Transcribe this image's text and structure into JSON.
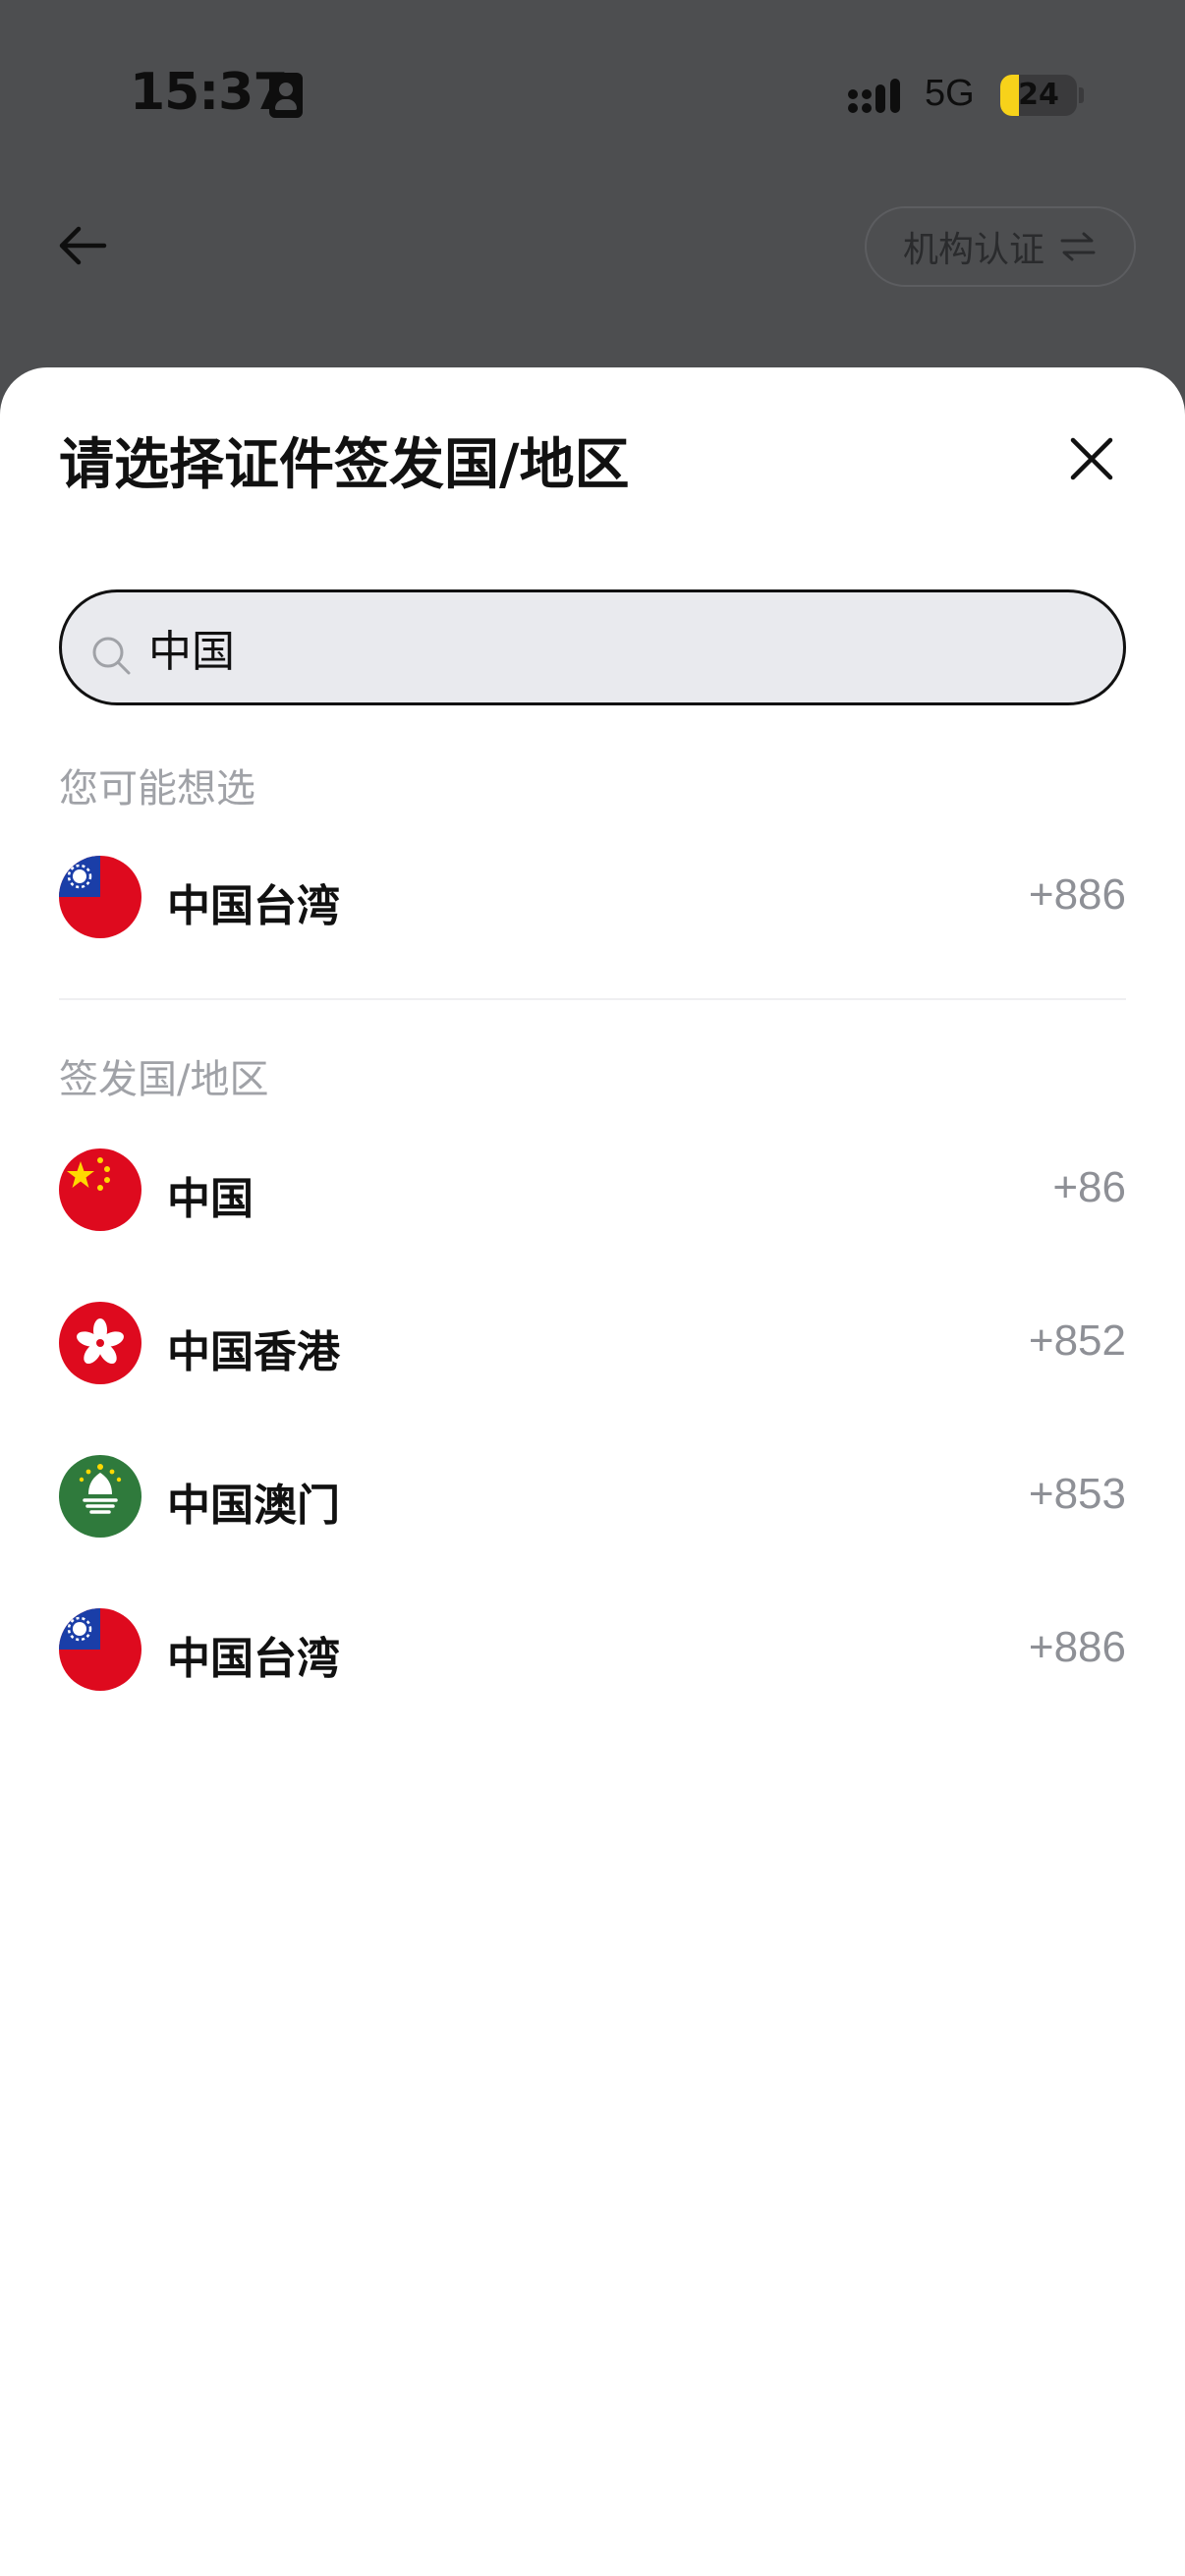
{
  "status_bar": {
    "time": "15:37",
    "network": "5G",
    "battery_level": "24",
    "battery_fraction": 0.24
  },
  "header": {
    "switch_label": "机构认证"
  },
  "sheet": {
    "title": "请选择证件签发国/地区",
    "search": {
      "value": "中国",
      "placeholder": ""
    },
    "suggested_label": "您可能想选",
    "suggested": [
      {
        "name": "中国台湾",
        "code": "+886",
        "flag_icon": "taiwan-flag-icon"
      }
    ],
    "list_label": "签发国/地区",
    "list": [
      {
        "name": "中国",
        "code": "+86",
        "flag_icon": "china-flag-icon"
      },
      {
        "name": "中国香港",
        "code": "+852",
        "flag_icon": "hong-kong-flag-icon"
      },
      {
        "name": "中国澳门",
        "code": "+853",
        "flag_icon": "macau-flag-icon"
      },
      {
        "name": "中国台湾",
        "code": "+886",
        "flag_icon": "taiwan-flag-icon"
      }
    ]
  },
  "colors": {
    "overlay": "#4d4e50",
    "sheet_bg": "#ffffff",
    "search_bg": "#e9eaee",
    "muted_text": "#a0a2a7",
    "code_text": "#8e9096",
    "flag_red": "#de0a1e",
    "flag_blue": "#1a3ea8",
    "flag_green": "#2f7a3c",
    "flag_yellow": "#ffd900"
  }
}
